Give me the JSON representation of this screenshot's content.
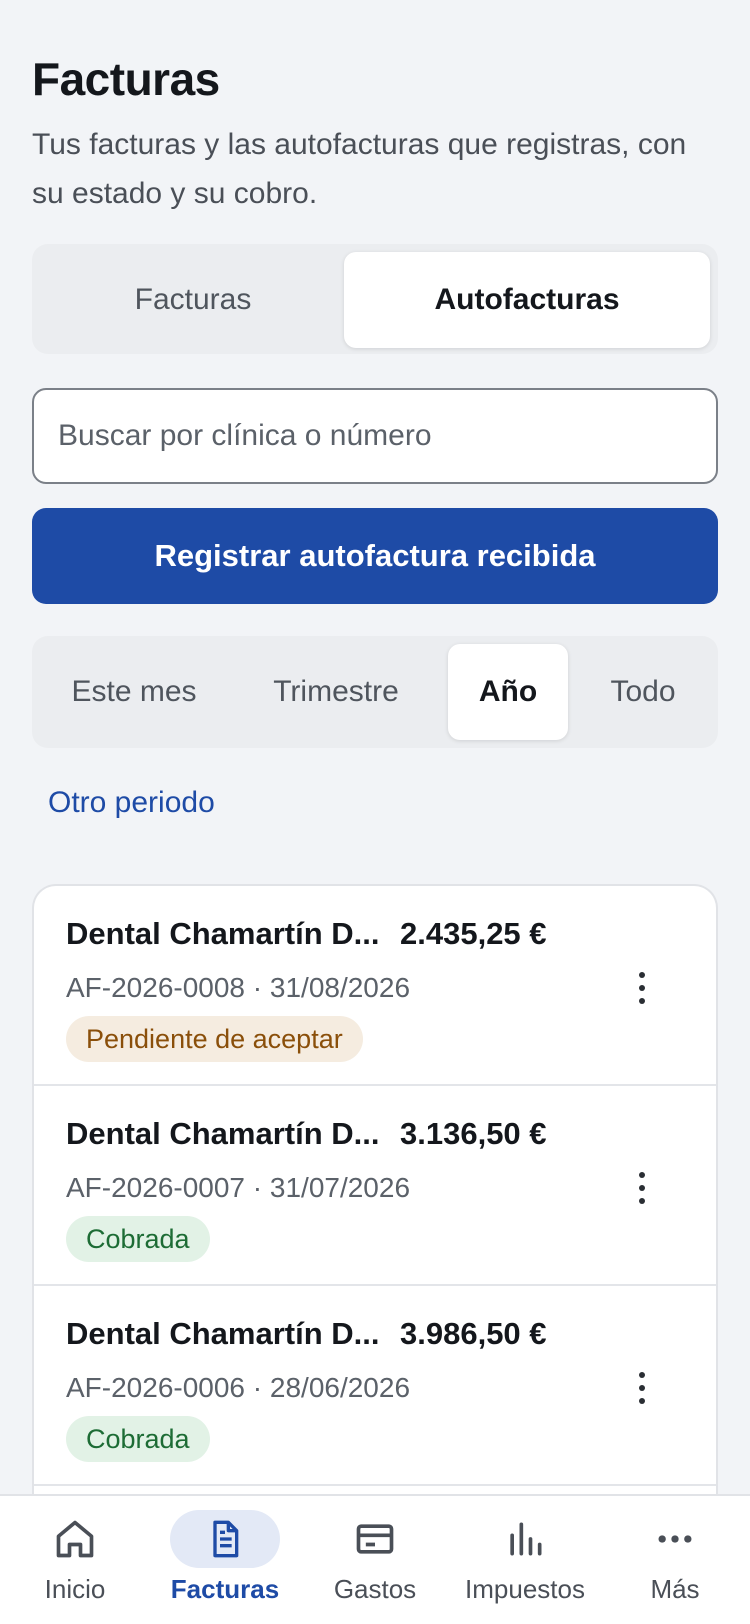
{
  "header": {
    "title": "Facturas",
    "subtitle": "Tus facturas y las autofacturas que registras, con su estado y su cobro."
  },
  "segment": {
    "options": [
      "Facturas",
      "Autofacturas"
    ],
    "selected": "Autofacturas"
  },
  "search": {
    "placeholder": "Buscar por clínica o número"
  },
  "primary_button": "Registrar autofactura recibida",
  "period_filter": {
    "options": [
      "Este mes",
      "Trimestre",
      "Año",
      "Todo"
    ],
    "selected": "Año"
  },
  "other_period_link": "Otro periodo",
  "invoices": [
    {
      "name": "Dental Chamartín D...",
      "amount": "2.435,25 €",
      "meta": "AF-2026-0008 · 31/08/2026",
      "status": "Pendiente de aceptar",
      "status_type": "pending"
    },
    {
      "name": "Dental Chamartín D...",
      "amount": "3.136,50 €",
      "meta": "AF-2026-0007 · 31/07/2026",
      "status": "Cobrada",
      "status_type": "paid"
    },
    {
      "name": "Dental Chamartín D...",
      "amount": "3.986,50 €",
      "meta": "AF-2026-0006 · 28/06/2026",
      "status": "Cobrada",
      "status_type": "paid"
    }
  ],
  "tabbar": {
    "items": [
      {
        "label": "Inicio",
        "icon": "home-icon"
      },
      {
        "label": "Facturas",
        "icon": "document-icon"
      },
      {
        "label": "Gastos",
        "icon": "card-icon"
      },
      {
        "label": "Impuestos",
        "icon": "bar-chart-icon"
      },
      {
        "label": "Más",
        "icon": "more-horizontal-icon"
      }
    ],
    "active": "Facturas"
  },
  "colors": {
    "accent": "#1e4ba6",
    "background": "#f2f4f7",
    "pending_bg": "#f5ece0",
    "pending_text": "#8a4f0a",
    "paid_bg": "#e2f2e6",
    "paid_text": "#1d6c35"
  }
}
